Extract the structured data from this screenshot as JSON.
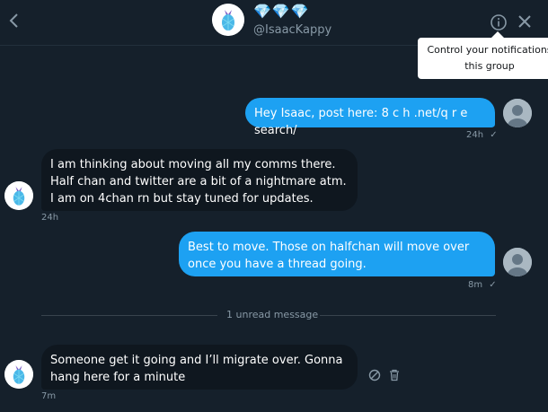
{
  "header": {
    "title": "💎💎💎",
    "handle": "@IsaacKappy",
    "back_icon": "chevron-left-icon",
    "info_icon": "info-icon",
    "close_icon": "close-icon"
  },
  "tooltip": {
    "line1": "Control your notifications",
    "line2": "this group"
  },
  "messages": [
    {
      "direction": "sent",
      "text": "Hey Isaac, post here: 8 c h .net/q r e search/",
      "time": "24h",
      "read_icon": "check-icon"
    },
    {
      "direction": "received",
      "text": "I am thinking about moving all my comms there. Half chan and twitter are a bit of a nightmare atm. I am on 4chan rn but stay tuned for updates.",
      "time": "24h"
    },
    {
      "direction": "sent",
      "text": "Best to move. Those on halfchan will move over once you have a thread going.",
      "time": "8m",
      "read_icon": "check-icon"
    },
    {
      "direction": "received",
      "text": "Someone get it going and I’ll migrate over. Gonna hang here for a minute",
      "time": "7m"
    }
  ],
  "divider": {
    "label": "1 unread message"
  },
  "message_actions": {
    "report_icon": "block-icon",
    "delete_icon": "trash-icon"
  },
  "colors": {
    "background": "#15202b",
    "sent_bubble": "#1da1f2",
    "received_bubble": "#0f171f",
    "muted_text": "#8899a6"
  }
}
